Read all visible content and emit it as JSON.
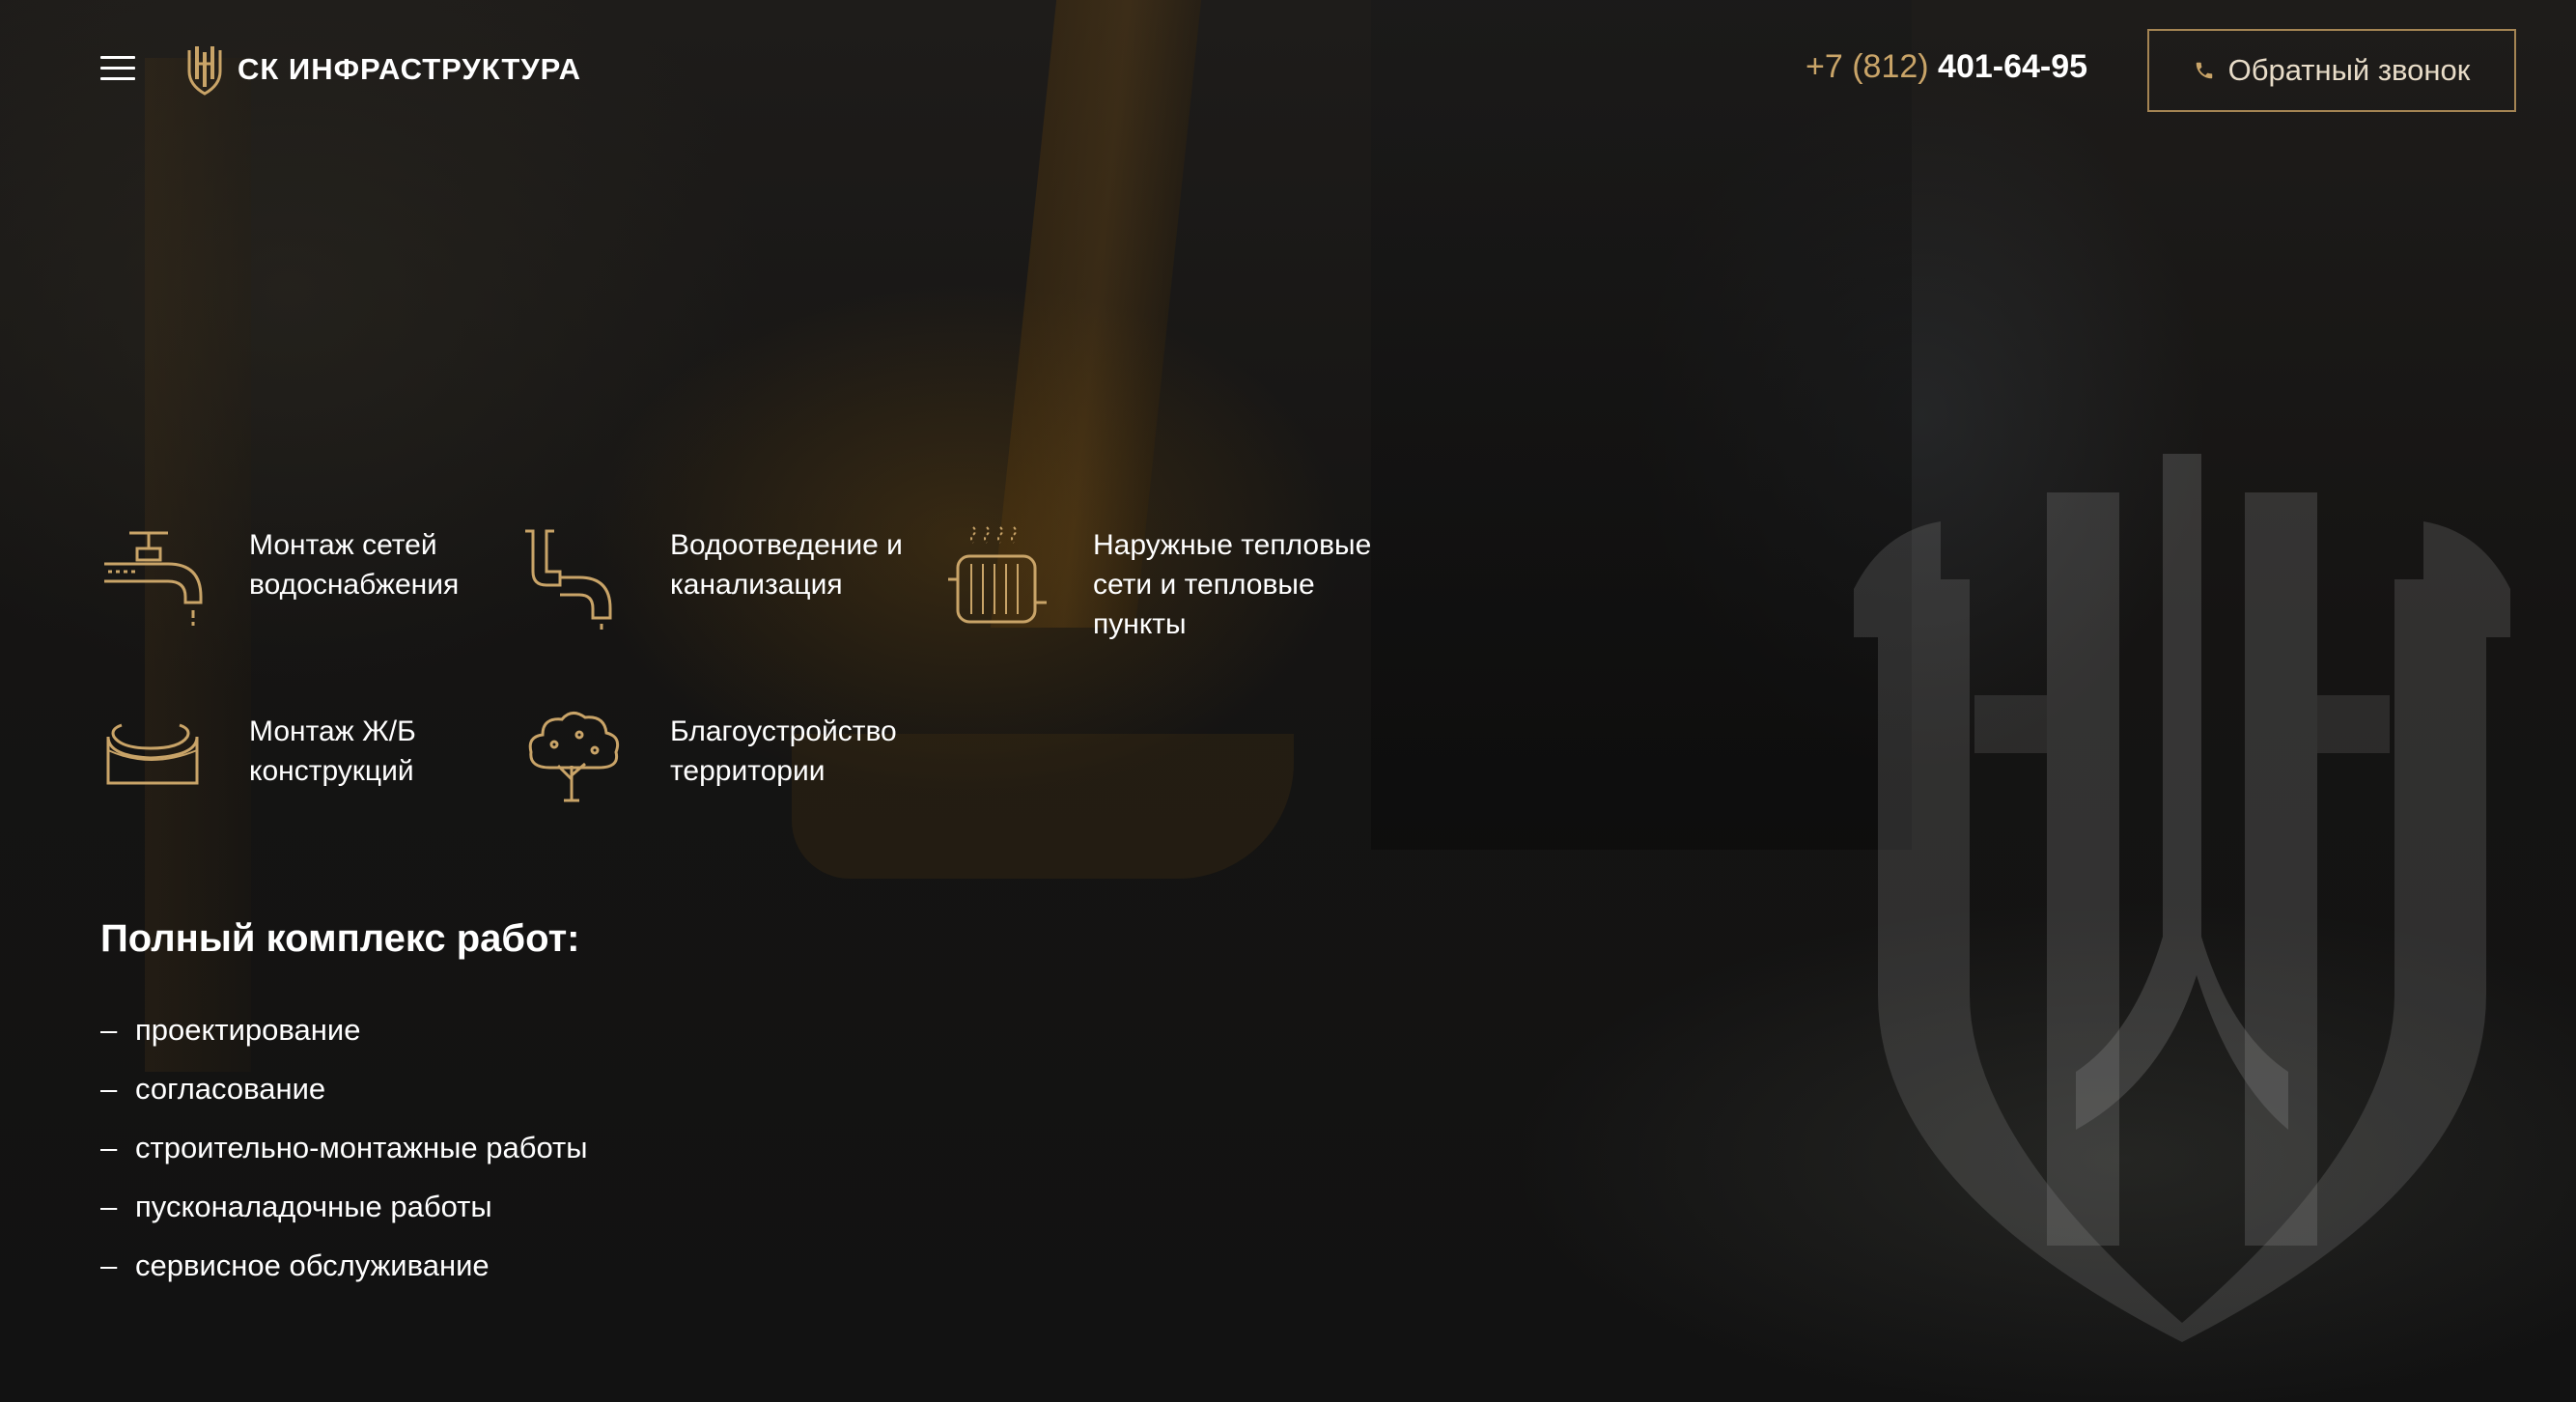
{
  "header": {
    "company_name": "СК ИНФРАСТРУКТУРА",
    "phone_prefix": "+7 (812)",
    "phone_number": "401-64-95",
    "callback_label": "Обратный звонок"
  },
  "services": [
    {
      "label": "Монтаж сетей водоснабжения",
      "icon": "water-tap-icon"
    },
    {
      "label": "Водоотведение и канализация",
      "icon": "drain-pipe-icon"
    },
    {
      "label": "Наружные тепловые сети и тепловые пункты",
      "icon": "radiator-icon"
    },
    {
      "label": "Монтаж Ж/Б конструкций",
      "icon": "concrete-ring-icon"
    },
    {
      "label": "Благоустройство территории",
      "icon": "tree-icon"
    }
  ],
  "works": {
    "title": "Полный комплекс работ:",
    "items": [
      "проектирование",
      "согласование",
      "строительно-монтажные работы",
      "пусконаладочные работы",
      "сервисное обслуживание"
    ]
  },
  "colors": {
    "accent": "#c9a468",
    "button_border": "#a48453",
    "background": "#161514",
    "text": "#ffffff"
  }
}
